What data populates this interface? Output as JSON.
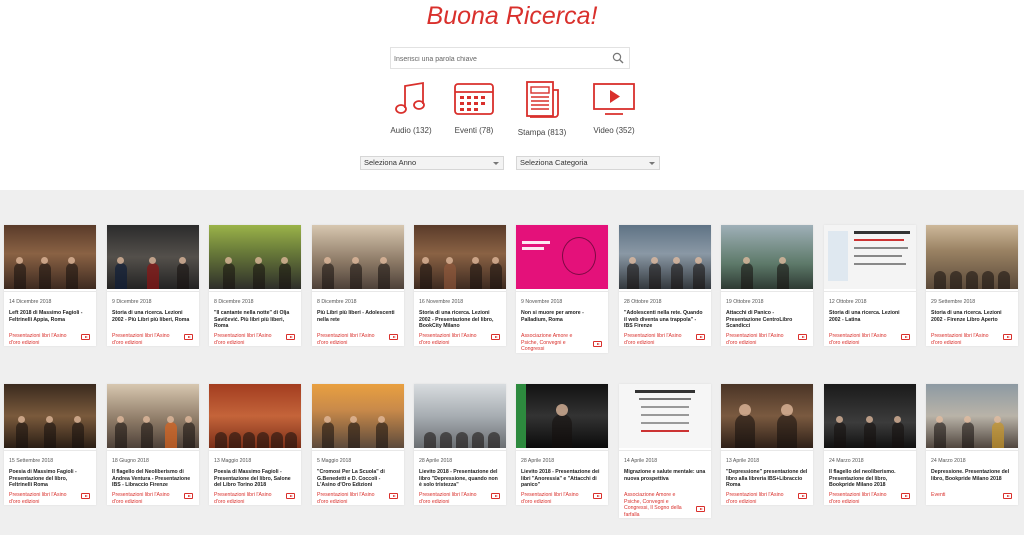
{
  "header": {
    "title": "Buona Ricerca!"
  },
  "search": {
    "placeholder": "Inserisci una parola chiave"
  },
  "media_types": [
    {
      "label": "Audio (132)",
      "icon": "music-note-icon"
    },
    {
      "label": "Eventi (78)",
      "icon": "calendar-icon"
    },
    {
      "label": "Stampa (813)",
      "icon": "newspaper-icon"
    },
    {
      "label": "Video (352)",
      "icon": "video-play-icon"
    }
  ],
  "filters": {
    "year": "Seleziona Anno",
    "category": "Seleziona Categoria"
  },
  "colors": {
    "accent": "#d9302c",
    "background": "#efefef"
  },
  "cards": [
    {
      "date": "14 Dicembre 2018",
      "title": "Left 2018 di Massimo Fagioli - Feltrinelli Appia, Roma",
      "category": "Presentazioni libri l'Asino d'oro edizioni"
    },
    {
      "date": "9 Dicembre 2018",
      "title": "Storia di una ricerca. Lezioni 2002 - Più Libri più liberi, Roma",
      "category": "Presentazioni libri l'Asino d'oro edizioni"
    },
    {
      "date": "8 Dicembre 2018",
      "title": "\"Il cantante nella notte\" di Olja Savičević. Più libri più liberi, Roma",
      "category": "Presentazioni libri l'Asino d'oro edizioni"
    },
    {
      "date": "8 Dicembre 2018",
      "title": "Più Libri più liberi - Adolescenti nella rete",
      "category": "Presentazioni libri l'Asino d'oro edizioni"
    },
    {
      "date": "16 Novembre 2018",
      "title": "Storia di una ricerca. Lezioni 2002 - Presentazione del libro, BookCity Milano",
      "category": "Presentazioni libri l'Asino d'oro edizioni"
    },
    {
      "date": "9 Novembre 2018",
      "title": "Non si muore per amore - Palladium, Roma",
      "category": "Associazione Amore e Psiche, Convegni e Congressi"
    },
    {
      "date": "28 Ottobre 2018",
      "title": "\"Adolescenti nella rete. Quando il web diventa una trappola\" - IBS Firenze",
      "category": "Presentazioni libri l'Asino d'oro edizioni"
    },
    {
      "date": "19 Ottobre 2018",
      "title": "Attacchi di Panico - Presentazione CentroLibro Scandicci",
      "category": "Presentazioni libri l'Asino d'oro edizioni"
    },
    {
      "date": "12 Ottobre 2018",
      "title": "Storia di una ricerca. Lezioni 2002 - Latina",
      "category": "Presentazioni libri l'Asino d'oro edizioni"
    },
    {
      "date": "29 Settembre 2018",
      "title": "Storia di una ricerca. Lezioni 2002 - Firenze Libro Aperto",
      "category": "Presentazioni libri l'Asino d'oro edizioni"
    },
    {
      "date": "15 Settembre 2018",
      "title": "Poesia di Massimo Fagioli - Presentazione del libro, Feltrinelli Roma",
      "category": "Presentazioni libri l'Asino d'oro edizioni"
    },
    {
      "date": "18 Giugno 2018",
      "title": "Il flagello del Neoliberismo di Andrea Ventura - Presentazione IBS - Libraccio Firenze",
      "category": "Presentazioni libri l'Asino d'oro edizioni"
    },
    {
      "date": "13 Maggio 2018",
      "title": "Poesia di Massimo Fagioli - Presentazione del libro, Salone del Libro Torino 2018",
      "category": "Presentazioni libri l'Asino d'oro edizioni"
    },
    {
      "date": "5 Maggio 2018",
      "title": "\"Cromosi Per La Scuola\" di G.Benedetti e D. Coccoli - L'Asino d'Oro Edizioni",
      "category": "Presentazioni libri l'Asino d'oro edizioni"
    },
    {
      "date": "28 Aprile 2018",
      "title": "Lievito 2018 - Presentazione del libro \"Depressione, quando non è solo tristezza\"",
      "category": "Presentazioni libri l'Asino d'oro edizioni"
    },
    {
      "date": "28 Aprile 2018",
      "title": "Lievito 2018 - Presentazione dei libri \"Anoressia\" e \"Attacchi di panico\"",
      "category": "Presentazioni libri l'Asino d'oro edizioni"
    },
    {
      "date": "14 Aprile 2018",
      "title": "Migrazione e salute mentale: una nuova prospettiva",
      "category": "Associazione Amore e Psiche, Convegni e Congressi, Il Sogno della farfalla"
    },
    {
      "date": "13 Aprile 2018",
      "title": "\"Depressione\" presentazione del libro alla libreria IBS+Libraccio Roma",
      "category": "Presentazioni libri l'Asino d'oro edizioni"
    },
    {
      "date": "24 Marzo 2018",
      "title": "Il flagello del neoliberismo. Presentazione del libro, Bookpride Milano 2018",
      "category": "Presentazioni libri l'Asino d'oro edizioni"
    },
    {
      "date": "24 Marzo 2018",
      "title": "Depressione. Presentazione del libro, Bookpride Milano 2018",
      "category": "Eventi"
    }
  ]
}
